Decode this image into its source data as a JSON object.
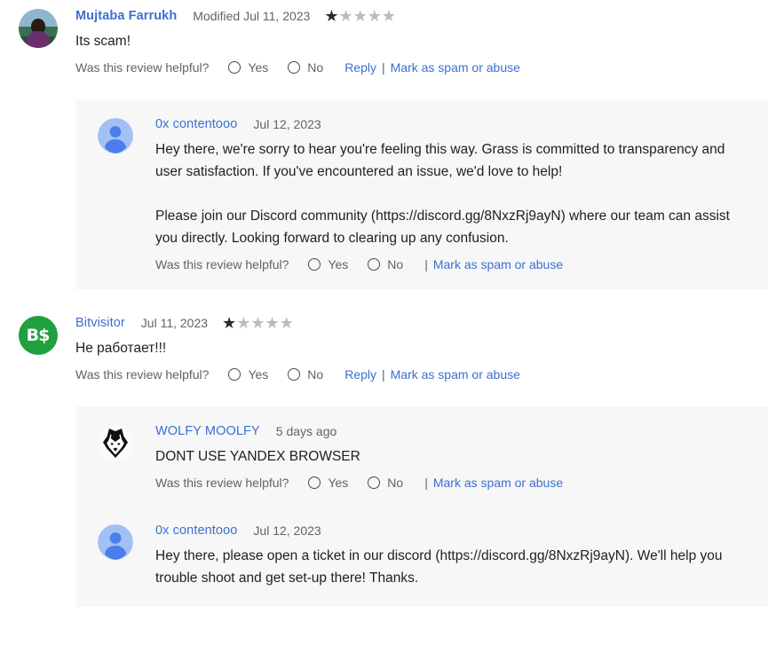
{
  "labels": {
    "helpful_question": "Was this review helpful?",
    "yes": "Yes",
    "no": "No",
    "reply": "Reply",
    "mark_spam": "Mark as spam or abuse",
    "separator": "|"
  },
  "colors": {
    "link": "#3c6fd0",
    "muted": "#5f6368",
    "reply_background": "#f7f7f7",
    "star_filled": "#2b2b2b",
    "star_empty": "#b8bcc2",
    "avatar_green": "#21a03f"
  },
  "reviews": [
    {
      "author": "Mujtaba Farrukh",
      "date": "Modified Jul 11, 2023",
      "rating": 1,
      "max_rating": 5,
      "text": "Its scam!",
      "avatar": "photo-avatar-mujtaba",
      "replies": [
        {
          "author": "0x contentooo",
          "date": "Jul 12, 2023",
          "avatar": "default-person-avatar",
          "paragraphs": [
            "Hey there, we're sorry to hear you're feeling this way. Grass is committed to transparency and user satisfaction. If you've encountered an issue, we'd love to help!",
            "Please join our Discord community (https://discord.gg/8NxzRj9ayN) where our team can assist you directly. Looking forward to clearing up any confusion."
          ]
        }
      ]
    },
    {
      "author": "Bitvisitor",
      "date": "Jul 11, 2023",
      "rating": 1,
      "max_rating": 5,
      "text": "Не работает!!!",
      "avatar": "bs-logo-avatar",
      "avatar_text": "B$",
      "replies": [
        {
          "author": "WOLFY MOOLFY",
          "date": "5 days ago",
          "avatar": "wolf-head-avatar",
          "paragraphs": [
            "DONT USE YANDEX BROWSER"
          ]
        },
        {
          "author": "0x contentooo",
          "date": "Jul 12, 2023",
          "avatar": "default-person-avatar",
          "paragraphs": [
            "Hey there, please open a ticket in our discord (https://discord.gg/8NxzRj9ayN). We'll help you trouble shoot and get set-up there! Thanks."
          ]
        }
      ]
    }
  ]
}
